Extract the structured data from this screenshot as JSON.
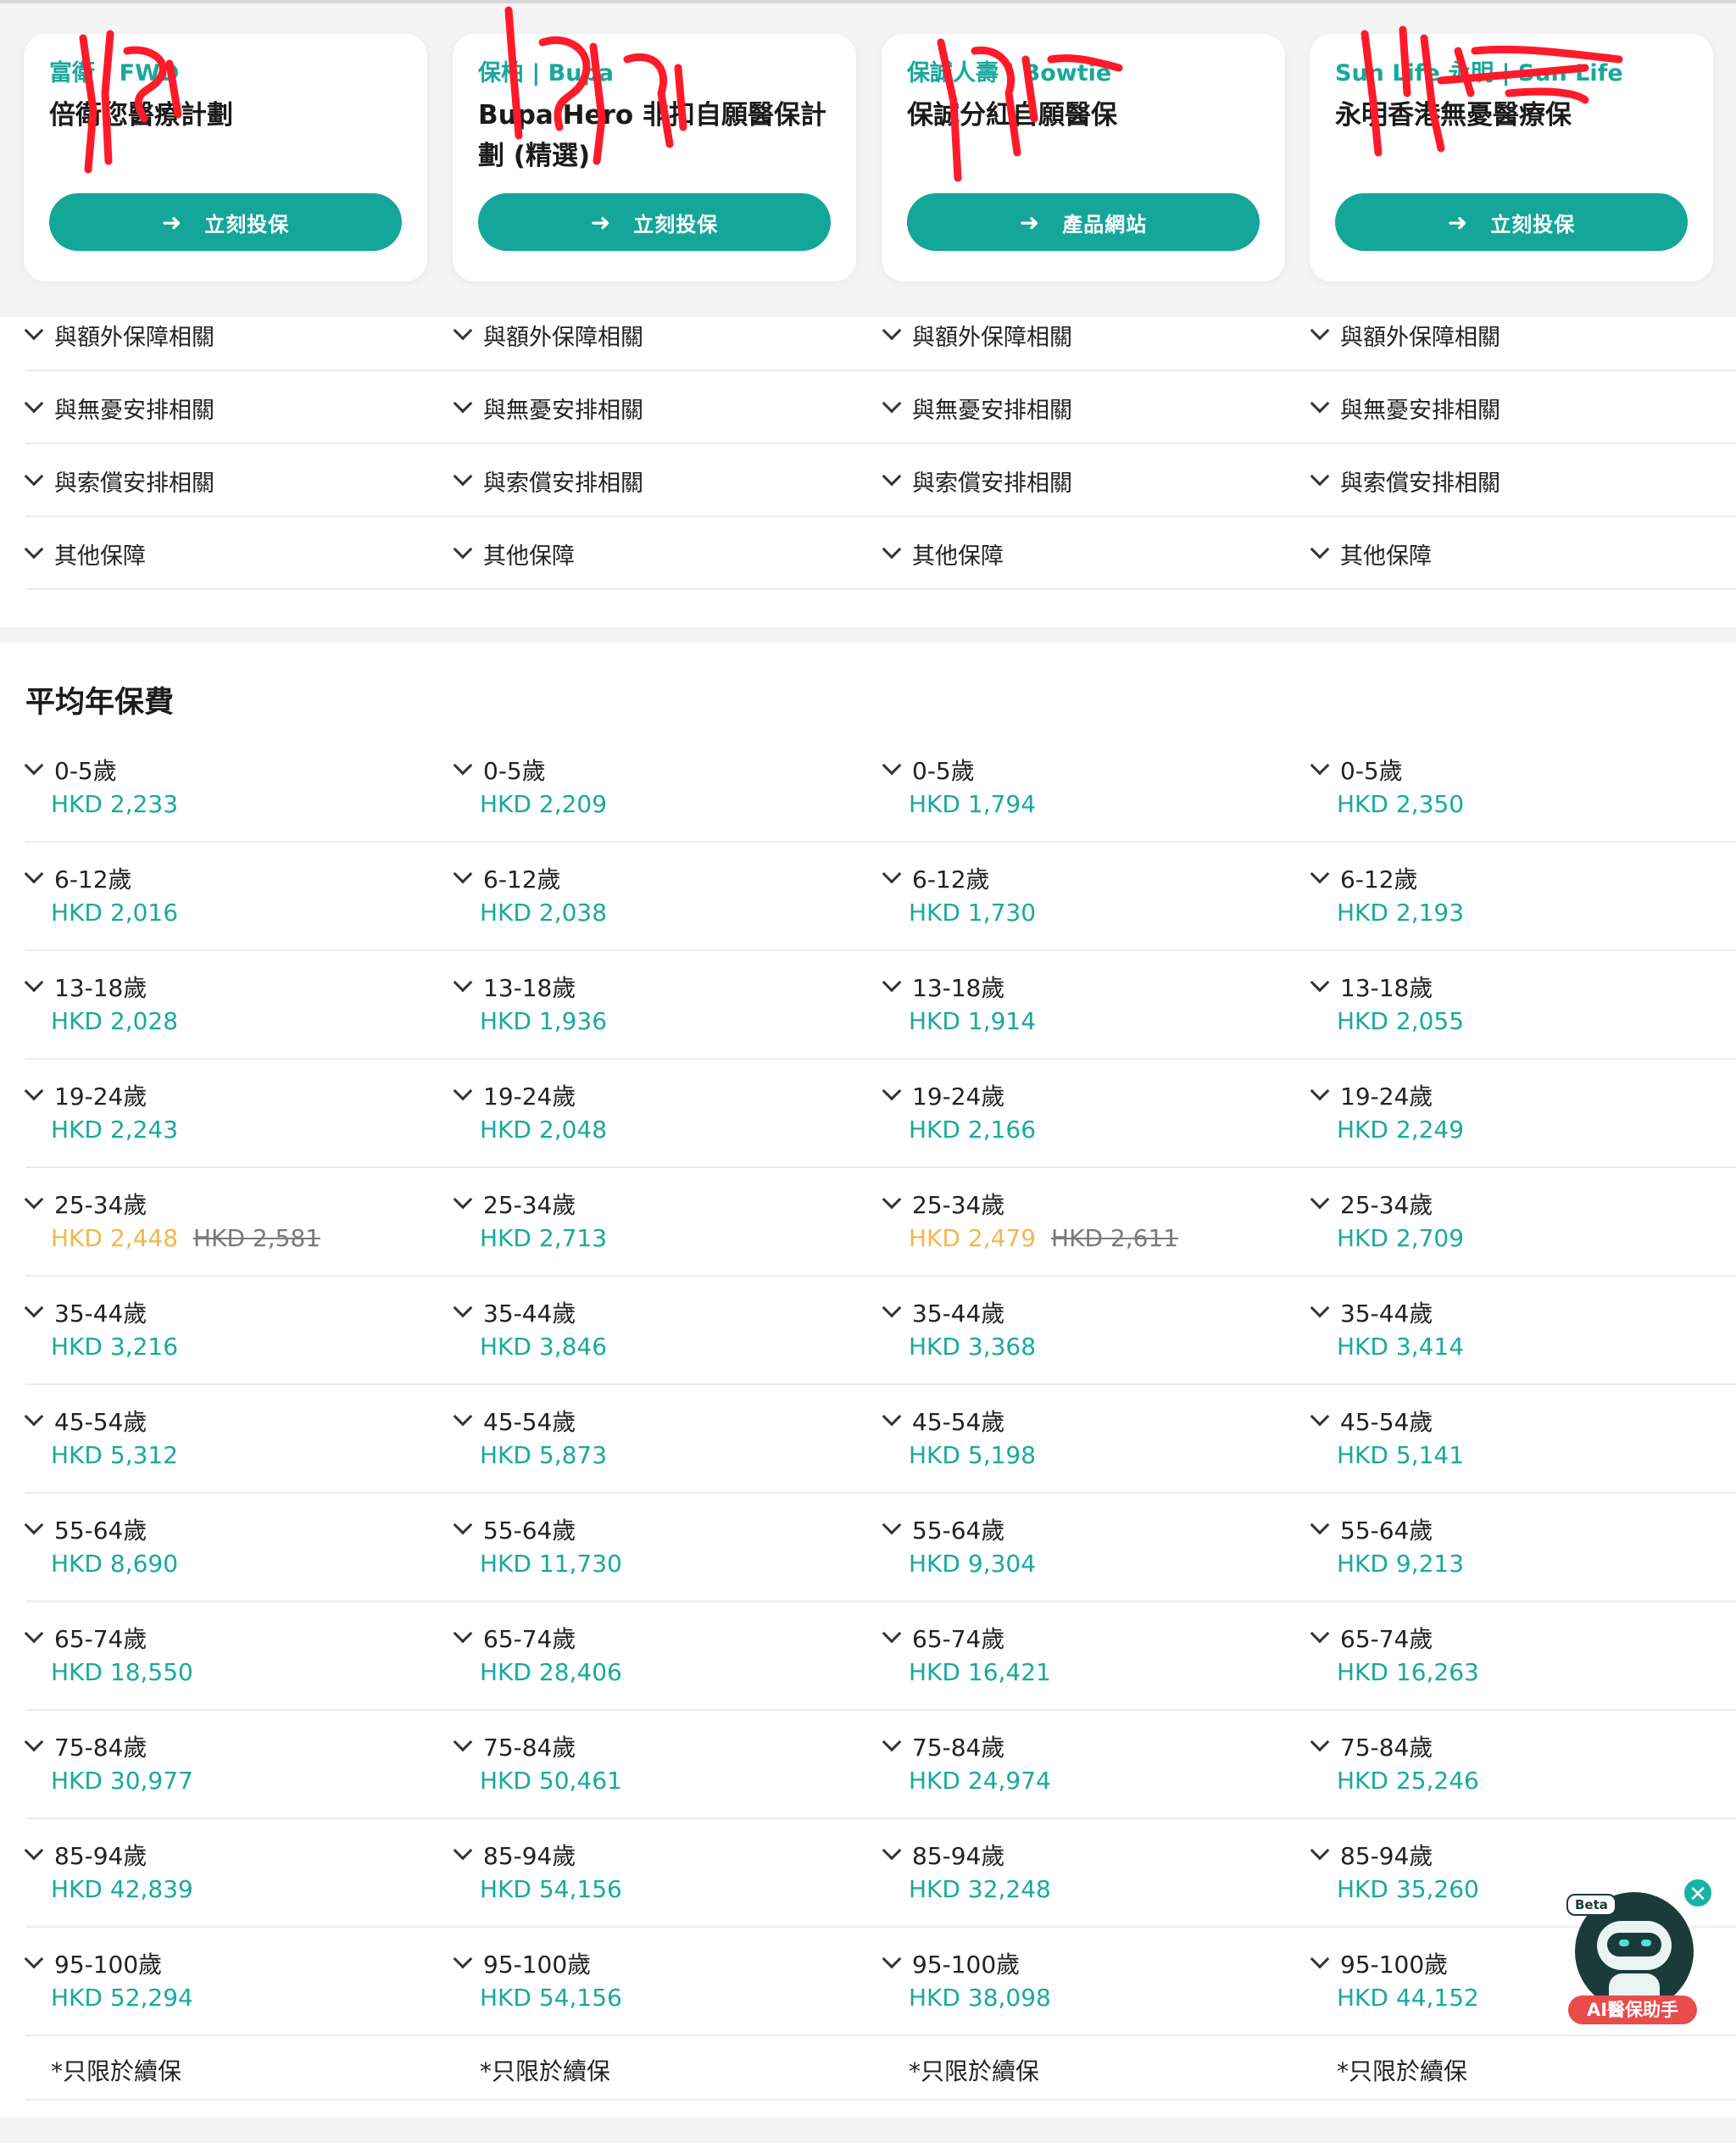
{
  "colors": {
    "accent": "#14a699",
    "price": "#19a99d",
    "promo_price": "#f2b84b",
    "scribble": "#ff1a2a",
    "ai_label_bg": "#ea4b4b"
  },
  "plans": [
    {
      "provider": "富衛 | FWD",
      "name": "倍衛您醫療計劃",
      "button": "立刻投保"
    },
    {
      "provider": "保柏 | Bupa",
      "name": "Bupa Hero 非扣自願醫保計劃 (精選)",
      "button": "立刻投保"
    },
    {
      "provider": "保誠人壽 | Bowtie",
      "name": "保誠分紅自願醫保",
      "button": "產品網站"
    },
    {
      "provider": "Sun Life 永明 | Sun Life",
      "name": "永明香港無憂醫療保",
      "button": "立刻投保"
    }
  ],
  "sections": [
    "與額外保障相關",
    "與無憂安排相關",
    "與索償安排相關",
    "其他保障"
  ],
  "premium_title": "平均年保費",
  "premiums": [
    {
      "age": "0-5歲",
      "prices": [
        "HKD 2,233",
        "HKD 2,209",
        "HKD 1,794",
        "HKD 2,350"
      ]
    },
    {
      "age": "6-12歲",
      "prices": [
        "HKD 2,016",
        "HKD 2,038",
        "HKD 1,730",
        "HKD 2,193"
      ]
    },
    {
      "age": "13-18歲",
      "prices": [
        "HKD 2,028",
        "HKD 1,936",
        "HKD 1,914",
        "HKD 2,055"
      ]
    },
    {
      "age": "19-24歲",
      "prices": [
        "HKD 2,243",
        "HKD 2,048",
        "HKD 2,166",
        "HKD 2,249"
      ]
    },
    {
      "age": "25-34歲",
      "prices": [
        "HKD 2,448",
        "HKD 2,713",
        "HKD 2,479",
        "HKD 2,709"
      ],
      "old": [
        "HKD 2,581",
        "",
        "HKD 2,611",
        ""
      ]
    },
    {
      "age": "35-44歲",
      "prices": [
        "HKD 3,216",
        "HKD 3,846",
        "HKD 3,368",
        "HKD 3,414"
      ]
    },
    {
      "age": "45-54歲",
      "prices": [
        "HKD 5,312",
        "HKD 5,873",
        "HKD 5,198",
        "HKD 5,141"
      ]
    },
    {
      "age": "55-64歲",
      "prices": [
        "HKD 8,690",
        "HKD 11,730",
        "HKD 9,304",
        "HKD 9,213"
      ]
    },
    {
      "age": "65-74歲",
      "prices": [
        "HKD 18,550",
        "HKD 28,406",
        "HKD 16,421",
        "HKD 16,263"
      ]
    },
    {
      "age": "75-84歲",
      "prices": [
        "HKD 30,977",
        "HKD 50,461",
        "HKD 24,974",
        "HKD 25,246"
      ]
    },
    {
      "age": "85-94歲",
      "prices": [
        "HKD 42,839",
        "HKD 54,156",
        "HKD 32,248",
        "HKD 35,260"
      ]
    },
    {
      "age": "95-100歲",
      "prices": [
        "HKD 52,294",
        "HKD 54,156",
        "HKD 38,098",
        "HKD 44,152"
      ]
    }
  ],
  "note": "*只限於續保",
  "ai_widget": {
    "beta": "Beta",
    "label": "AI醫保助手",
    "close": "✕"
  },
  "icons": {
    "arrow": "arrow-right-icon",
    "chevron": "chevron-down-icon",
    "close": "close-icon"
  }
}
